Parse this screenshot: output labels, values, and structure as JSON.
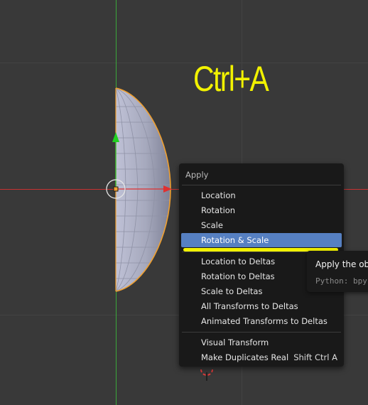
{
  "viewport": {
    "hint_text": "Ctrl+A",
    "colors": {
      "background": "#393939",
      "grid": "#434343",
      "x_axis": "#c83232",
      "y_axis": "#3aa83a",
      "mesh": "#a8abbf",
      "selection_outline": "#f0a030",
      "hint": "#f2f200",
      "annotation": "#f2f200"
    }
  },
  "menu": {
    "title": "Apply",
    "items": [
      {
        "label": "Location"
      },
      {
        "label": "Rotation"
      },
      {
        "label": "Scale"
      },
      {
        "label": "Rotation & Scale",
        "active": true
      },
      {
        "label": "Location to Deltas"
      },
      {
        "label": "Rotation to Deltas"
      },
      {
        "label": "Scale to Deltas"
      },
      {
        "label": "All Transforms to Deltas"
      },
      {
        "label": "Animated Transforms to Deltas"
      },
      {
        "label": "Visual Transform"
      },
      {
        "label": "Make Duplicates Real",
        "shortcut": "Shift Ctrl A"
      }
    ],
    "highlight_color": "#5680c2"
  },
  "tooltip": {
    "title": "Apply the obj",
    "python": "Python: bpy"
  }
}
